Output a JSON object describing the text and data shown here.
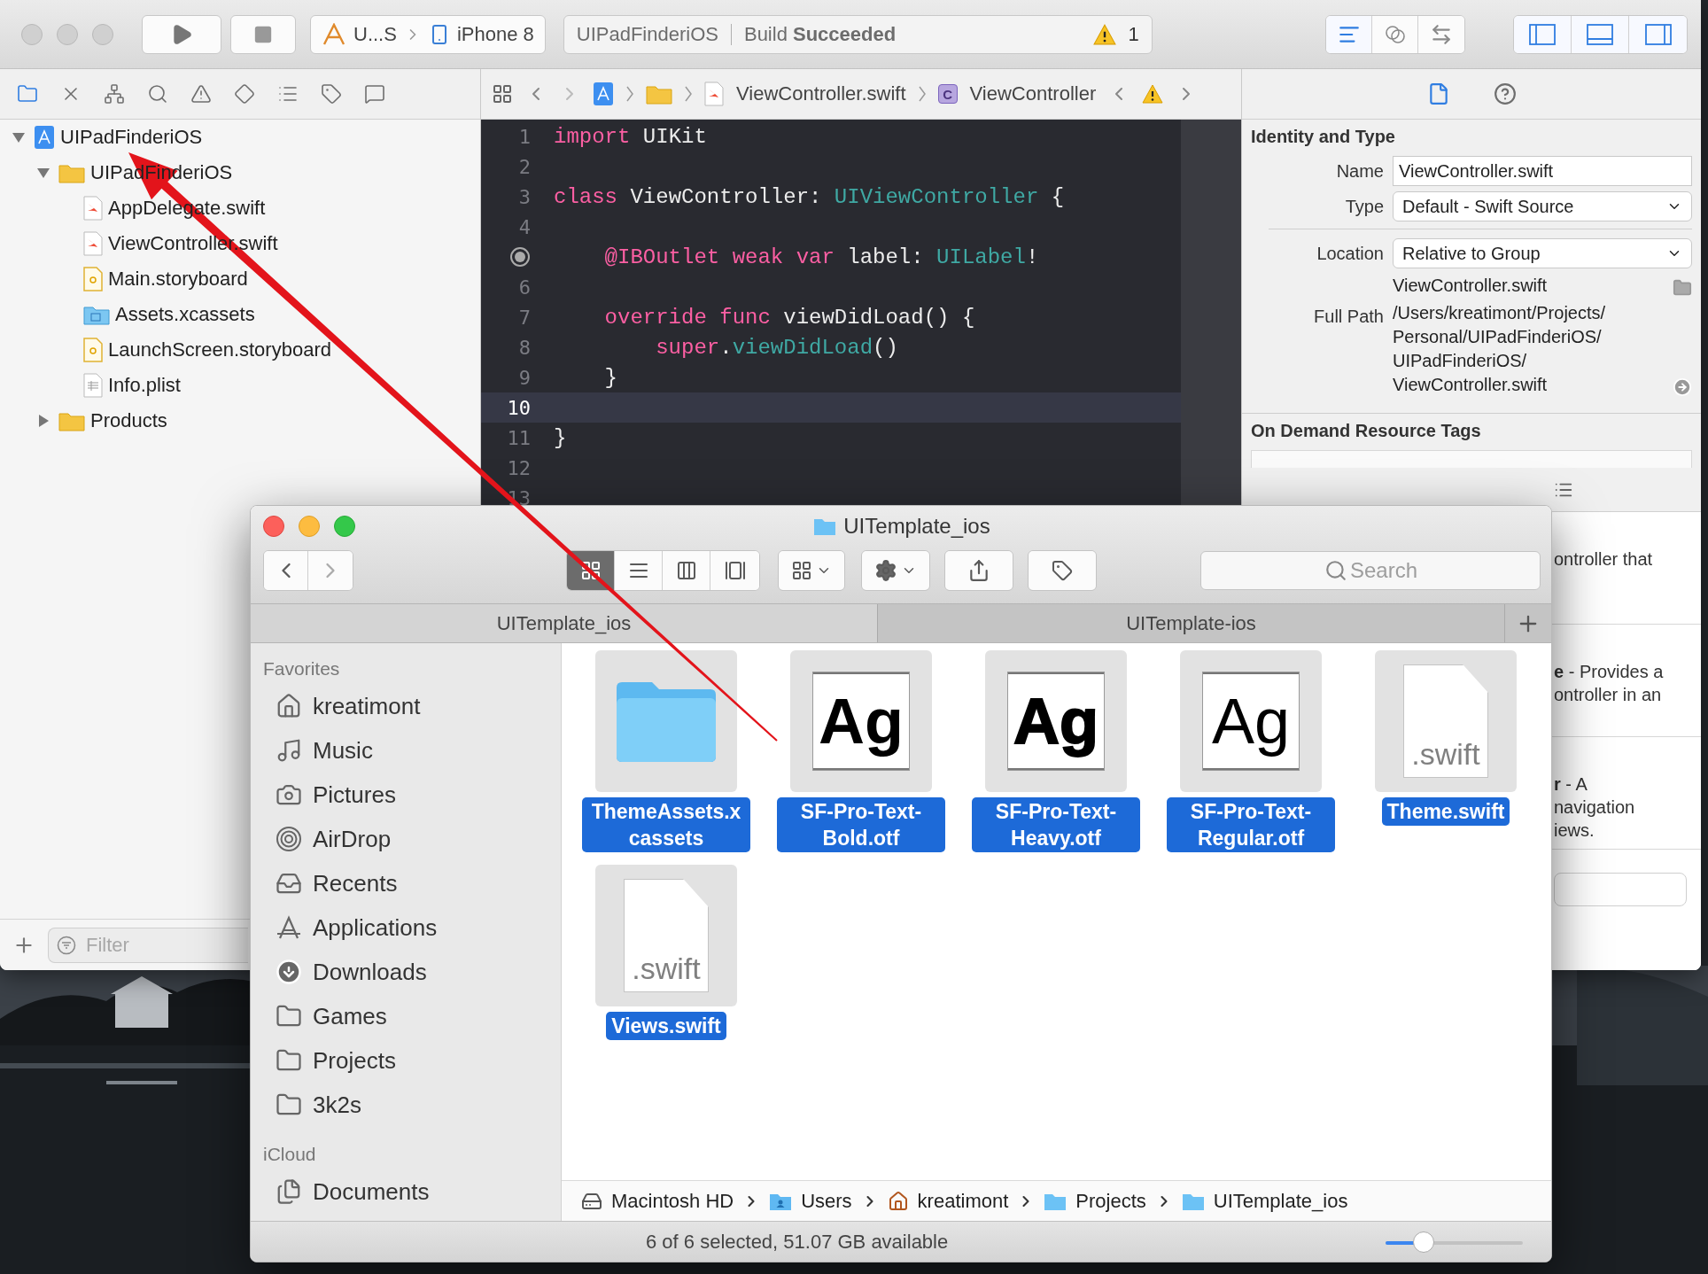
{
  "xcode": {
    "toolbar": {
      "scheme": "U...S",
      "device": "iPhone 8",
      "status_project": "UIPadFinderiOS",
      "status_text": "Build **Succeeded**",
      "warning_count": "1",
      "editor_modes": [
        {
          "selected": true
        },
        {
          "selected": false
        },
        {
          "selected": false
        }
      ],
      "panels": [
        {
          "on": true
        },
        {
          "on": true
        },
        {
          "on": true
        }
      ]
    },
    "navigator_tabs": [
      {
        "selected": true
      },
      {
        "selected": false
      },
      {
        "selected": false
      },
      {
        "selected": false
      },
      {
        "selected": false
      },
      {
        "selected": false
      },
      {
        "selected": false
      },
      {
        "selected": false
      },
      {
        "selected": false
      }
    ],
    "jump_bar": {
      "file": "ViewController.swift",
      "class_badge": "C",
      "symbol": "ViewController"
    },
    "inspector_tabs": [
      {
        "selected": true
      },
      {
        "selected": false
      }
    ],
    "navigator": {
      "tree": [
        {
          "label": "UIPadFinderiOS",
          "kind": "project",
          "expanded": true,
          "children": [
            {
              "label": "UIPadFinderiOS",
              "kind": "folder",
              "expanded": true,
              "children": [
                {
                  "label": "AppDelegate.swift",
                  "kind": "swift"
                },
                {
                  "label": "ViewController.swift",
                  "kind": "swift"
                },
                {
                  "label": "Main.storyboard",
                  "kind": "storyboard"
                },
                {
                  "label": "Assets.xcassets",
                  "kind": "assets"
                },
                {
                  "label": "LaunchScreen.storyboard",
                  "kind": "storyboard"
                },
                {
                  "label": "Info.plist",
                  "kind": "plist"
                }
              ]
            },
            {
              "label": "Products",
              "kind": "folder",
              "expanded": false
            }
          ]
        }
      ],
      "filter": {
        "placeholder": "Filter"
      }
    },
    "editor": {
      "lines": [
        {
          "number": "1",
          "outlet": false,
          "current": false,
          "tokens": [
            {
              "text": "import",
              "kind": "keyword"
            },
            {
              "text": " UIKit",
              "kind": "plain"
            }
          ]
        },
        {
          "number": "2",
          "outlet": false,
          "current": false
        },
        {
          "number": "3",
          "outlet": false,
          "current": false,
          "tokens": [
            {
              "text": "class",
              "kind": "keyword"
            },
            {
              "text": " ViewController: ",
              "kind": "plain"
            },
            {
              "text": "UIViewController",
              "kind": "type"
            },
            {
              "text": " {",
              "kind": "plain"
            }
          ]
        },
        {
          "number": "4",
          "outlet": false,
          "current": false
        },
        {
          "outlet": true,
          "current": false,
          "tokens": [
            {
              "text": "    @IBOutlet weak var",
              "kind": "keyword"
            },
            {
              "text": " label: ",
              "kind": "plain"
            },
            {
              "text": "UILabel",
              "kind": "type"
            },
            {
              "text": "!",
              "kind": "plain"
            }
          ]
        },
        {
          "number": "6",
          "outlet": false,
          "current": false
        },
        {
          "number": "7",
          "outlet": false,
          "current": false,
          "tokens": [
            {
              "text": "    override func",
              "kind": "keyword"
            },
            {
              "text": " viewDidLoad() {",
              "kind": "plain"
            }
          ]
        },
        {
          "number": "8",
          "outlet": false,
          "current": false,
          "tokens": [
            {
              "text": "        super",
              "kind": "keyword"
            },
            {
              "text": ".",
              "kind": "plain"
            },
            {
              "text": "viewDidLoad",
              "kind": "type"
            },
            {
              "text": "()",
              "kind": "plain"
            }
          ]
        },
        {
          "number": "9",
          "outlet": false,
          "current": false,
          "tokens": [
            {
              "text": "    }",
              "kind": "plain"
            }
          ]
        },
        {
          "number": "10",
          "outlet": false,
          "current": true
        },
        {
          "number": "11",
          "outlet": false,
          "current": false,
          "tokens": [
            {
              "text": "}",
              "kind": "plain"
            }
          ]
        },
        {
          "number": "12",
          "outlet": false,
          "current": false
        },
        {
          "number": "13",
          "outlet": false,
          "current": false
        }
      ]
    },
    "inspector": {
      "section_title": "Identity and Type",
      "name": {
        "label": "Name",
        "value": "ViewController.swift"
      },
      "type": {
        "label": "Type",
        "value": "Default - Swift Source"
      },
      "location": {
        "label": "Location",
        "value": "Relative to Group"
      },
      "relative_path": "ViewController.swift",
      "full_path": {
        "label": "Full Path",
        "lines": [
          "/Users/kreatimont/Projects/",
          "Personal/UIPadFinderiOS/",
          "UIPadFinderiOS/",
          "ViewController.swift"
        ]
      },
      "tags_title": "On Demand Resource Tags",
      "library_items": [
        {
          "lines": [
            "ontroller that"
          ]
        },
        {
          "lines": [
            "**e** - Provides a",
            "ontroller in an"
          ]
        },
        {
          "lines": [
            "**r** - A",
            "navigation",
            "iews."
          ]
        }
      ]
    }
  },
  "finder": {
    "title": "UITemplate_ios",
    "view_modes": [
      {
        "selected": true
      },
      {
        "selected": false
      },
      {
        "selected": false
      },
      {
        "selected": false
      }
    ],
    "search": {
      "placeholder": "Search"
    },
    "tabs": [
      {
        "label": "UITemplate_ios",
        "selected": true
      },
      {
        "label": "UITemplate-ios",
        "selected": false
      }
    ],
    "sidebar": [
      {
        "heading": "Favorites",
        "items": [
          {
            "label": "kreatimont",
            "kind": "home"
          },
          {
            "label": "Music",
            "kind": "music"
          },
          {
            "label": "Pictures",
            "kind": "pictures"
          },
          {
            "label": "AirDrop",
            "kind": "airdrop"
          },
          {
            "label": "Recents",
            "kind": "recents"
          },
          {
            "label": "Applications",
            "kind": "applications"
          },
          {
            "label": "Downloads",
            "kind": "downloads"
          },
          {
            "label": "Games",
            "kind": "folder"
          },
          {
            "label": "Projects",
            "kind": "folder"
          },
          {
            "label": "3k2s",
            "kind": "folder"
          }
        ]
      },
      {
        "heading": "iCloud",
        "items": [
          {
            "label": "Documents",
            "kind": "documents"
          }
        ]
      }
    ],
    "files": [
      {
        "name": "ThemeAssets.xcassets",
        "kind": "folder",
        "selected": true
      },
      {
        "name": "SF-Pro-Text-Bold.otf",
        "kind": "font",
        "bold": true,
        "heavy": false,
        "preview": "Ag",
        "selected": true
      },
      {
        "name": "SF-Pro-Text-Heavy.otf",
        "kind": "font",
        "bold": true,
        "heavy": true,
        "preview": "Ag",
        "selected": true
      },
      {
        "name": "SF-Pro-Text-Regular.otf",
        "kind": "font",
        "bold": false,
        "heavy": false,
        "preview": "Ag",
        "selected": true
      },
      {
        "name": "Theme.swift",
        "kind": "swift",
        "preview": ".swift",
        "selected": true
      },
      {
        "name": "Views.swift",
        "kind": "swift",
        "preview": ".swift",
        "selected": true
      }
    ],
    "path_bar": [
      {
        "label": "Macintosh HD",
        "kind": "disk"
      },
      {
        "label": "Users",
        "kind": "users"
      },
      {
        "label": "kreatimont",
        "kind": "home"
      },
      {
        "label": "Projects",
        "kind": "folder"
      },
      {
        "label": "UITemplate_ios",
        "kind": "folder"
      }
    ],
    "status": "6 of 6 selected, 51.07 GB available",
    "icon_size": {
      "level": 0.28
    }
  }
}
